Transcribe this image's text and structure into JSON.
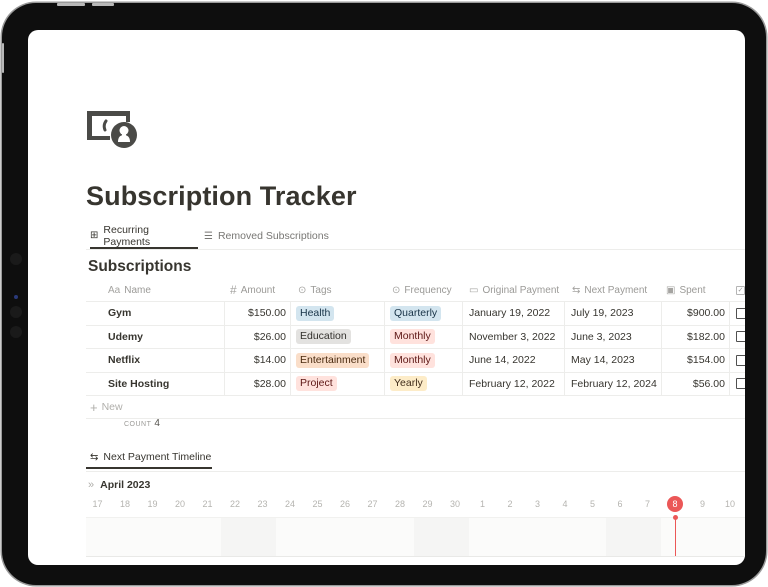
{
  "page": {
    "icon": "money-bill-icon",
    "title": "Subscription Tracker"
  },
  "views": [
    {
      "label": "Recurring Payments",
      "icon": "table-icon",
      "active": true
    },
    {
      "label": "Removed Subscriptions",
      "icon": "list-icon",
      "active": false
    }
  ],
  "database": {
    "title": "Subscriptions",
    "columns": [
      {
        "label": "Name",
        "icon": "text-icon",
        "icon_glyph": "Aa"
      },
      {
        "label": "Amount",
        "icon": "number-icon",
        "icon_glyph": "#"
      },
      {
        "label": "Tags",
        "icon": "select-icon",
        "icon_glyph": "⊙"
      },
      {
        "label": "Frequency",
        "icon": "select-icon",
        "icon_glyph": "⊙"
      },
      {
        "label": "Original Payment",
        "icon": "calendar-icon",
        "icon_glyph": "▭"
      },
      {
        "label": "Next Payment",
        "icon": "formula-icon",
        "icon_glyph": "⇆"
      },
      {
        "label": "Spent",
        "icon": "money-icon",
        "icon_glyph": "▣"
      },
      {
        "label": "",
        "icon": "checkbox-icon",
        "icon_glyph": "✓"
      }
    ],
    "rows": [
      {
        "name": "Gym",
        "amount": "$150.00",
        "tag": "Health",
        "tag_color": "blue",
        "frequency": "Quarterly",
        "frequency_color": "blue",
        "original_payment": "January 19, 2022",
        "next_payment": "July 19, 2023",
        "spent": "$900.00",
        "checked": false
      },
      {
        "name": "Udemy",
        "amount": "$26.00",
        "tag": "Education",
        "tag_color": "gray",
        "frequency": "Monthly",
        "frequency_color": "red",
        "original_payment": "November 3, 2022",
        "next_payment": "June 3, 2023",
        "spent": "$182.00",
        "checked": false
      },
      {
        "name": "Netflix",
        "amount": "$14.00",
        "tag": "Entertainment",
        "tag_color": "orange",
        "frequency": "Monthly",
        "frequency_color": "red",
        "original_payment": "June 14, 2022",
        "next_payment": "May 14, 2023",
        "spent": "$154.00",
        "checked": false
      },
      {
        "name": "Site Hosting",
        "amount": "$28.00",
        "tag": "Project",
        "tag_color": "red",
        "frequency": "Yearly",
        "frequency_color": "yellow",
        "original_payment": "February 12, 2022",
        "next_payment": "February 12, 2024",
        "spent": "$56.00",
        "checked": false
      }
    ],
    "new_label": "New",
    "count_label": "COUNT",
    "count_value": "4"
  },
  "timeline": {
    "tab_label": "Next Payment Timeline",
    "tab_icon": "formula-icon",
    "month_label": "April 2023",
    "expand_icon": "double-chevron-right-icon",
    "days": [
      "17",
      "18",
      "19",
      "20",
      "21",
      "22",
      "23",
      "24",
      "25",
      "26",
      "27",
      "28",
      "29",
      "30",
      "1",
      "2",
      "3",
      "4",
      "5",
      "6",
      "7",
      "8",
      "9",
      "10"
    ],
    "today": "8",
    "weekend_days": [
      "22",
      "23",
      "29",
      "30",
      "6",
      "7"
    ]
  },
  "tag_colors": {
    "blue": {
      "bg": "#d3e5ef",
      "fg": "#183347"
    },
    "gray": {
      "bg": "#e3e2e0",
      "fg": "#32302c"
    },
    "orange": {
      "bg": "#fadec9",
      "fg": "#49290e"
    },
    "red": {
      "bg": "#ffe2dd",
      "fg": "#5d1715"
    },
    "yellow": {
      "bg": "#fdecc8",
      "fg": "#402c1b"
    }
  },
  "accent_today": "#eb5757"
}
